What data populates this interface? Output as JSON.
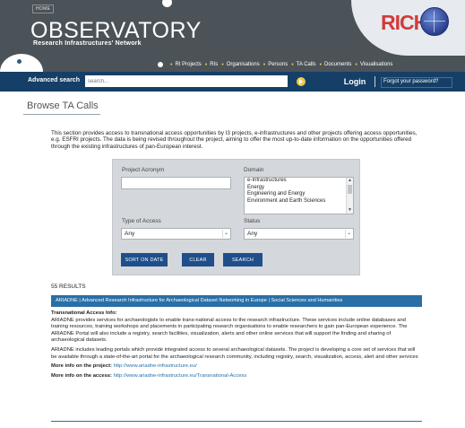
{
  "header": {
    "home_label": "HOME",
    "site_title": "OBSERVATORY",
    "site_subtitle": "Research Infrastructures' Network",
    "logo_text": "RICH",
    "nav": [
      "RI Projects",
      "RIs",
      "Organisations",
      "Persons",
      "TA Calls",
      "Documents",
      "Visualisations"
    ]
  },
  "search": {
    "label": "Advanced search",
    "placeholder": "search...",
    "login_label": "Login",
    "forgot_label": "Forgot your password?"
  },
  "page": {
    "title": "Browse TA Calls",
    "intro": "This section provides access to transnational access opportunities by I3 projects, e-infrastructures and other projects offering access opportunities, e.g. ESFRI projects. The data is being revised throughout the project, aiming to offer the most up-to-date information on the opportunities offered through the existing infrastructures of pan-European interest."
  },
  "filters": {
    "acronym_label": "Project Acronym",
    "acronym_value": "",
    "domain_label": "Domain",
    "domain_options": [
      "e-Infrastructures",
      "Energy",
      "Engineering and Energy",
      "Environment and Earth Sciences"
    ],
    "access_label": "Type of Access",
    "access_value": "Any",
    "status_label": "Status",
    "status_value": "Any",
    "sort_label": "SORT ON DATE",
    "clear_label": "CLEAR",
    "search_label": "SEARCH"
  },
  "results": {
    "count": "55 RESULTS",
    "first": {
      "header": "ARIADNE | Advanced Research Infrastructure for Archaeological Dataset Networking in Europe | Social Sciences and Humanities",
      "info_label": "Transnational Access Info:",
      "para1": "ARIADNE provides services for archaeologists to enable trans-national access to the research infrastructure. These services include online databases and training resources, training workshops and placements in participating research organisations to enable researchers to gain pan-European experience. The ARIADNE Portal will also include a registry, search facilities, visualization, alerts and other online services that will support the finding and sharing of archaeological datasets.",
      "para2": "ARIADNE includes leading portals which provide integrated access to several archaeological datasets. The project is developing a core set of services that will be available through a state-of-the-art portal for the archaeological research community, including registry, search, visualization, access, alert and other services",
      "project_label": "More info on the project:",
      "project_url": "http://www.ariadne-infrastructure.eu/",
      "access_label": "More info on the access:",
      "access_url": "http://www.ariadne-infrastructure.eu/Transnational-Access"
    }
  },
  "colors": {
    "header_bg": "#4c5358",
    "search_bar_bg": "#153f66",
    "accent_blue": "#2a6fa6",
    "button_blue": "#1f4f8a",
    "panel_bg": "#d4d8dc",
    "logo_red": "#d33a3a",
    "go_yellow": "#f2c94c"
  }
}
